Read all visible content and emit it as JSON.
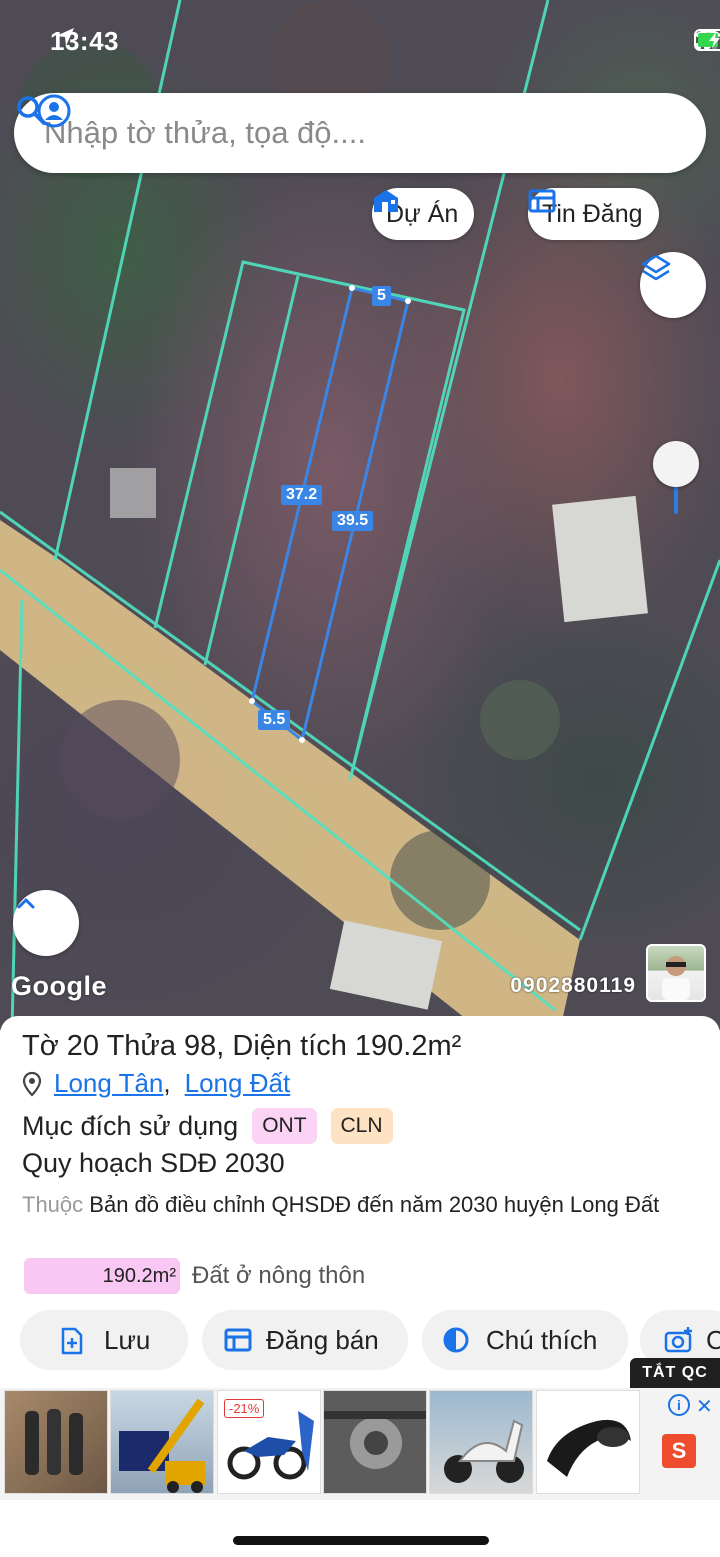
{
  "status_bar": {
    "time": "13:43"
  },
  "search": {
    "placeholder": "Nhập tờ thửa, tọa độ...."
  },
  "map_chips": {
    "project_label": "Dự Án",
    "listing_label": "Tin Đăng"
  },
  "map_labels": {
    "dimensions": [
      "5",
      "37.2",
      "39.5",
      "5.5"
    ],
    "google_logo": "Google",
    "phone": "0902880119"
  },
  "colors": {
    "boundary_line": "#4fe3c2",
    "selected_parcel": "#3a86e6",
    "accent_blue": "#1a73e8",
    "road": "#e6c98e",
    "ont_badge": "#fbd3f5",
    "cln_badge": "#fde3c3"
  },
  "parcel": {
    "title": "Tờ 20 Thửa 98, Diện tích 190.2m²",
    "ward": "Long Tân",
    "district": "Long Đất",
    "separator": ",",
    "purpose_label": "Mục đích sử dụng",
    "purpose_codes": [
      "ONT",
      "CLN"
    ],
    "plan_title": "Quy hoạch SDĐ 2030",
    "plan_prefix": "Thuộc",
    "plan_desc": "Bản đồ điều chỉnh QHSDĐ đến năm 2030 huyện Long Đất",
    "area_value": "190.2m²",
    "area_type": "Đất ở nông thôn"
  },
  "actions": {
    "save": "Lưu",
    "sell": "Đăng bán",
    "legend": "Chú thích",
    "camera_partial": "C"
  },
  "ads": {
    "close_label": "TẮT QC",
    "discount": "-21%",
    "info_symbol": "i",
    "close_symbol": "✕",
    "shop_symbol": "S"
  },
  "icons": [
    "location-arrow-icon",
    "signal-icon",
    "wifi-icon",
    "battery-icon",
    "account-icon",
    "search-icon",
    "house-icon",
    "table-icon",
    "layers-icon",
    "chevron-up-icon",
    "pin-icon",
    "add-doc-icon",
    "calendar-icon",
    "contrast-icon",
    "camera-icon",
    "info-icon",
    "close-icon",
    "shopee-icon"
  ]
}
